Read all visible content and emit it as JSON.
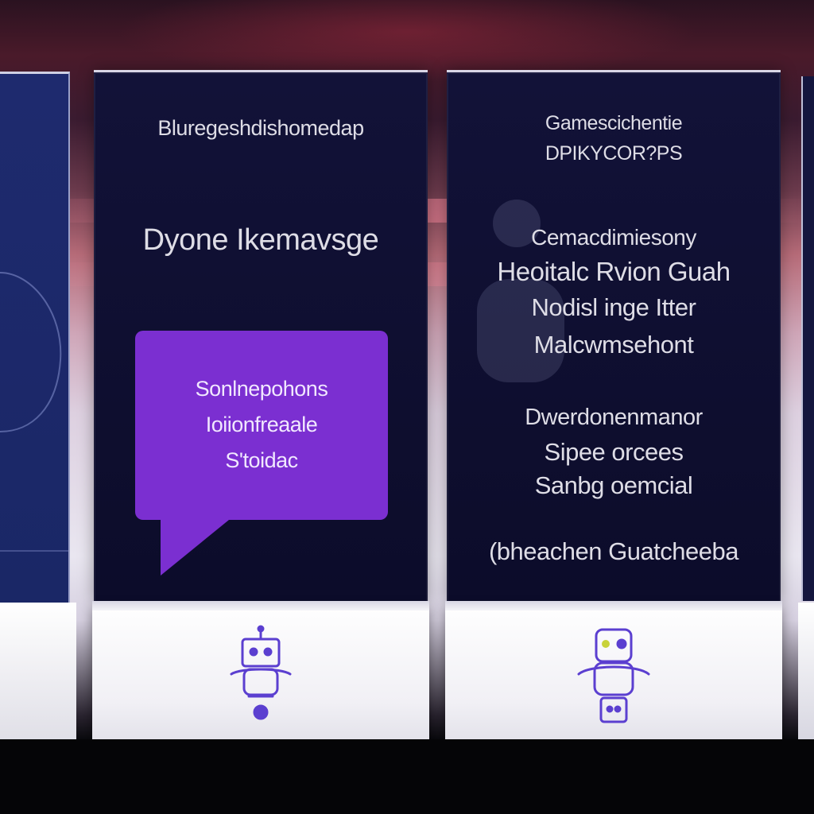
{
  "displays": [
    {
      "header": "Bluregeshdishomedap",
      "headline": "Dyone Ikemavsge",
      "bubble_lines": [
        "Sonlnepohons",
        "Ioiionfreaale",
        "S'toidac"
      ],
      "icon": "robot-icon"
    },
    {
      "header_lines": [
        "Gamescichentie",
        "DPIKYCOR?PS"
      ],
      "headline_lines": [
        "Cemacdimiesony",
        "Heoitalc Rvion Guah",
        "Nodisl inge Itter",
        "Malcwmsehont"
      ],
      "body_lines": [
        "Dwerdonenmanor",
        "Sipee orcees",
        "Sanbg oemcial"
      ],
      "footer": "(bheachen Guatcheeba",
      "icon": "robot-icon"
    }
  ],
  "colors": {
    "panel": "#0c0c2a",
    "bubble": "#7b2fd1",
    "text": "#dedde6",
    "base": "#f1f0f5",
    "icon": "#5b3fd0"
  }
}
